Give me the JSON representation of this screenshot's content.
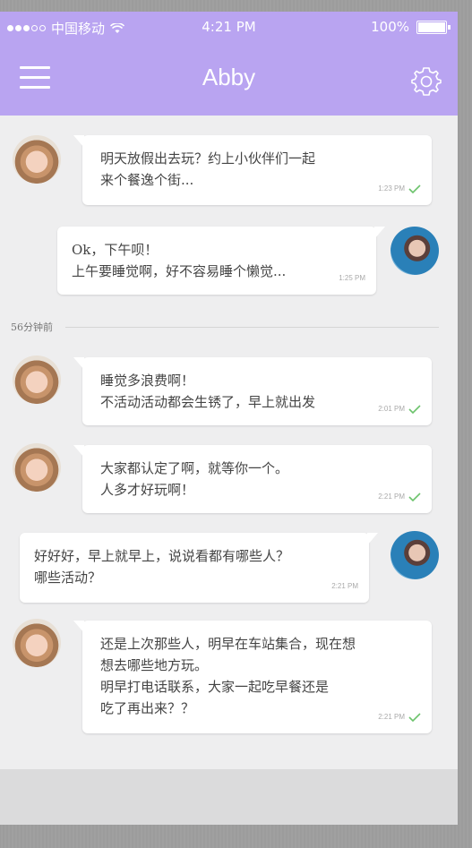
{
  "status": {
    "carrier": "中国移动",
    "time": "4:21 PM",
    "battery": "100%"
  },
  "nav": {
    "title": "Abby"
  },
  "messages": [
    {
      "side": "left",
      "avatar": "female-avatar",
      "text": "明天放假出去玩？约上小伙伴们一起\n来个餐逸个街...",
      "time": "1:23 PM",
      "read": true
    },
    {
      "side": "right",
      "avatar": "male-avatar",
      "text": "Ok，下午呗！\n上午要睡觉啊，好不容易睡个懒觉...",
      "time": "1:25 PM",
      "read": false
    },
    {
      "side": "left",
      "avatar": "female-avatar",
      "text": "睡觉多浪费啊！\n不活动活动都会生锈了，早上就出发",
      "time": "2:01 PM",
      "read": true
    },
    {
      "side": "left",
      "avatar": "female-avatar",
      "text": "大家都认定了啊，就等你一个。\n人多才好玩啊！",
      "time": "2:21 PM",
      "read": true
    },
    {
      "side": "right",
      "avatar": "male-avatar",
      "text": "好好好，早上就早上，说说看都有哪些人？\n哪些活动？",
      "time": "2:21 PM",
      "read": false
    },
    {
      "side": "left",
      "avatar": "female-avatar",
      "text": "还是上次那些人，明早在车站集合，现在想\n想去哪些地方玩。\n明早打电话联系，大家一起吃早餐还是\n吃了再出来？？",
      "time": "2:21 PM",
      "read": true
    }
  ],
  "divider": {
    "label": "56分钟前"
  },
  "colors": {
    "accent": "#b9a4f1",
    "read_check": "#6cc36c"
  }
}
